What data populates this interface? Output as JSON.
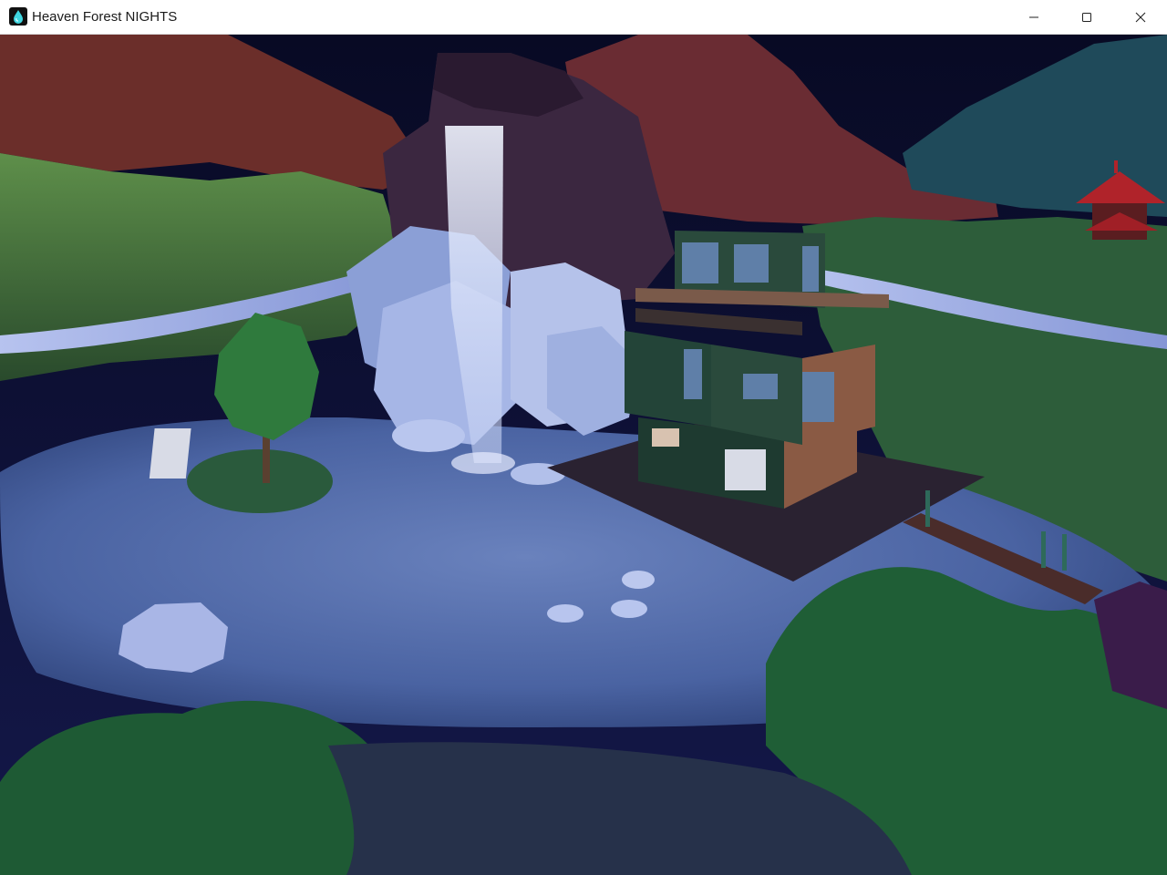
{
  "window": {
    "title": "Heaven Forest NIGHTS",
    "app_icon": "water-drop-icon",
    "controls": {
      "minimize_icon": "minimize-icon",
      "maximize_icon": "maximize-icon",
      "close_icon": "close-icon"
    }
  },
  "scene": {
    "sign_text": "",
    "colors": {
      "sky": "#0b0d2a",
      "water": "#4f6aa8",
      "grass": "#2f6a3c",
      "rock": "#3a2438",
      "mountain": "#6a2f2c",
      "foliage": "#1e6a3c",
      "deck": "#2b2230",
      "waterfall": "#c9d4f2"
    }
  }
}
